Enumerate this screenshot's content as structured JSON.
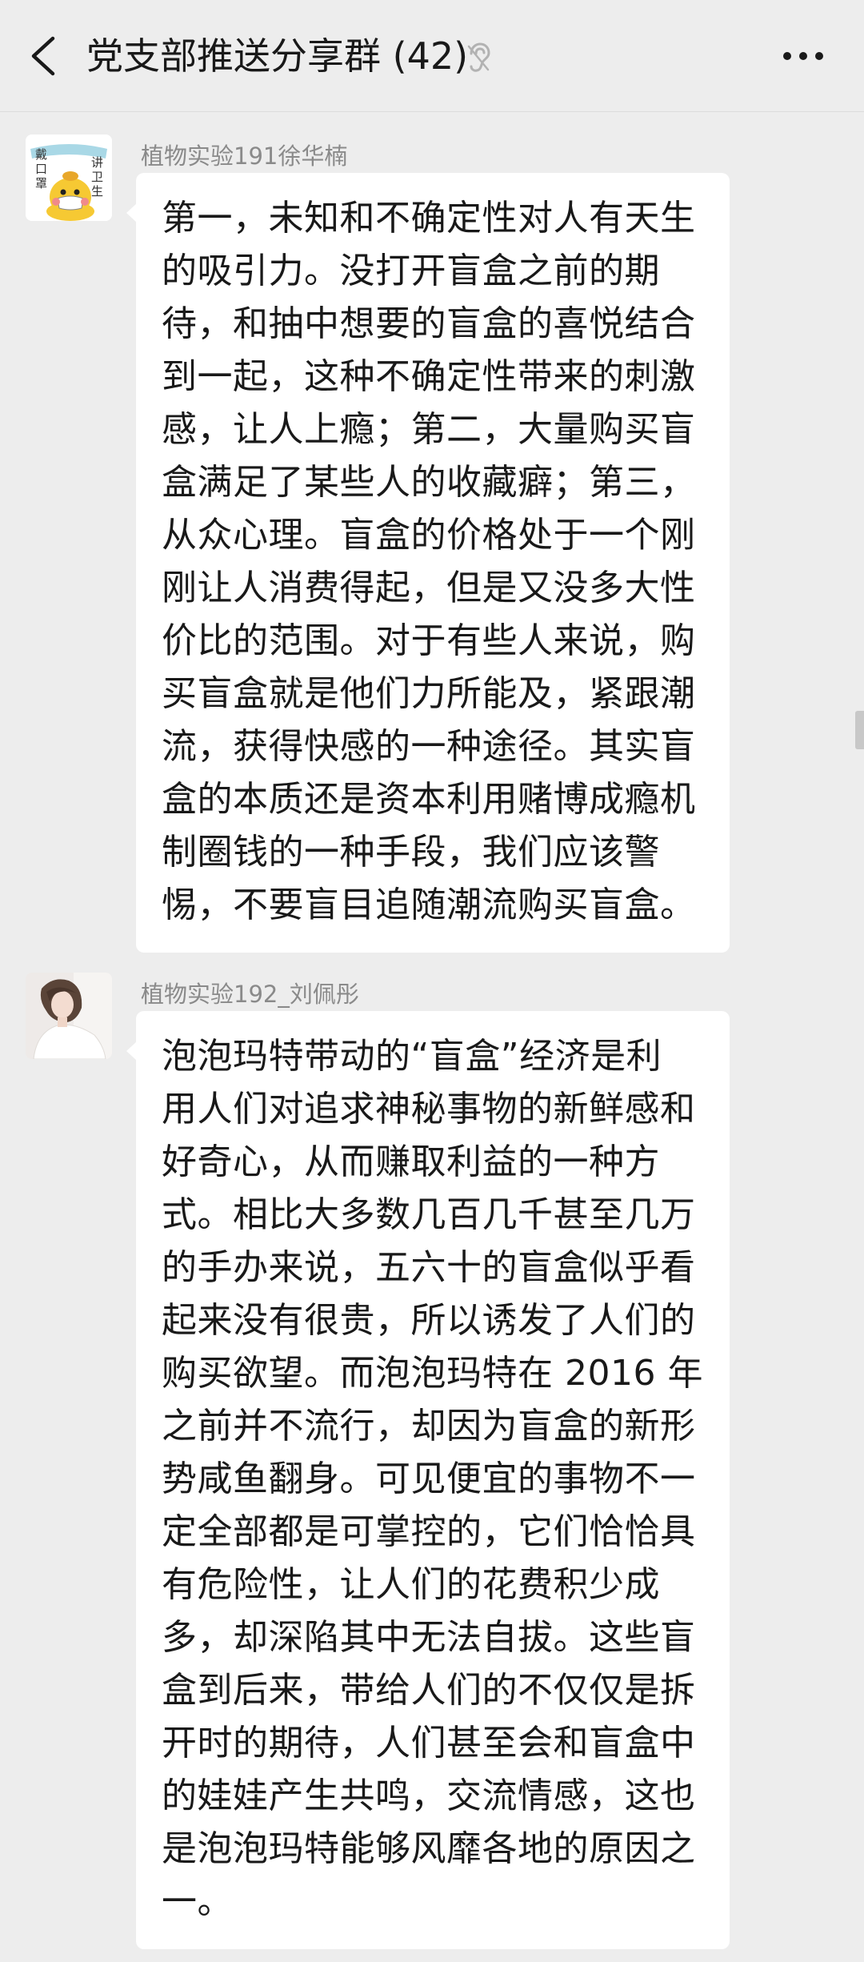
{
  "header": {
    "back_icon": "chevron-left-icon",
    "title": "党支部推送分享群 (42)",
    "mute_icon": "ear-muted-icon",
    "more_icon": "more-dots-icon"
  },
  "messages": [
    {
      "sender": "植物实验191徐华楠",
      "avatar_icon": "mask-duck-avatar",
      "avatar_text": [
        "戴",
        "口",
        "罩",
        "讲",
        "卫",
        "生"
      ],
      "text": "第一，未知和不确定性对人有天生\n的吸引力。没打开盲盒之前的期\n待，和抽中想要的盲盒的喜悦结合\n到一起，这种不确定性带来的刺激\n感，让人上瘾；第二，大量购买盲\n盒满足了某些人的收藏癖；第三，\n从众心理。盲盒的价格处于一个刚\n刚让人消费得起，但是又没多大性\n价比的范围。对于有些人来说，购\n买盲盒就是他们力所能及，紧跟潮\n流，获得快感的一种途径。其实盲\n盒的本质还是资本利用赌博成瘾机\n制圈钱的一种手段，我们应该警\n惕，不要盲目追随潮流购买盲盒。"
    },
    {
      "sender": "植物实验192_刘佩彤",
      "avatar_icon": "girl-photo-avatar",
      "text": "泡泡玛特带动的“盲盒”经济是利\n用人们对追求神秘事物的新鲜感和\n好奇心，从而赚取利益的一种方\n式。相比大多数几百几千甚至几万\n的手办来说，五六十的盲盒似乎看\n起来没有很贵，所以诱发了人们的\n购买欲望。而泡泡玛特在 2016 年\n之前并不流行，却因为盲盒的新形\n势咸鱼翻身。可见便宜的事物不一\n定全部都是可掌控的，它们恰恰具\n有危险性，让人们的花费积少成\n多，却深陷其中无法自拔。这些盲\n盒到后来，带给人们的不仅仅是拆\n开时的期待，人们甚至会和盲盒中\n的娃娃产生共鸣，交流情感，这也\n是泡泡玛特能够风靡各地的原因之\n一。"
    }
  ],
  "colors": {
    "background": "#ededed",
    "bubble": "#ffffff",
    "text": "#191919",
    "sender": "#8a8a8a"
  }
}
